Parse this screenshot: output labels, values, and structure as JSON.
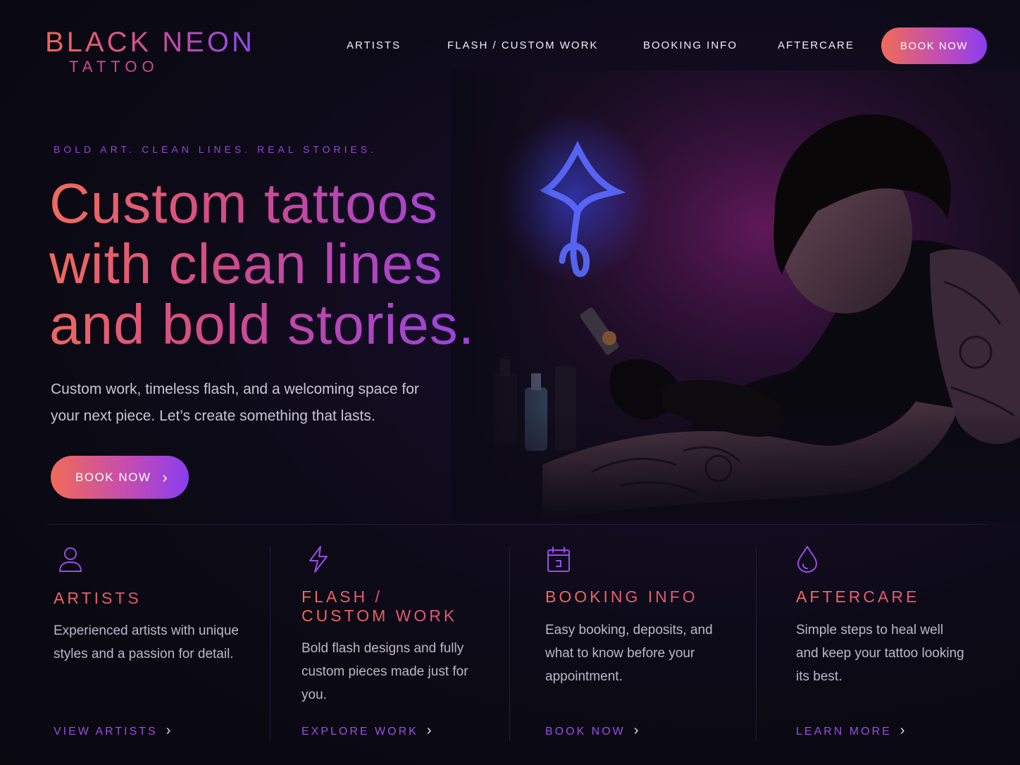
{
  "brand": {
    "name": "BLACK NEON",
    "sub": "TATTOO"
  },
  "nav": {
    "items": [
      "ARTISTS",
      "FLASH / CUSTOM WORK",
      "BOOKING INFO",
      "AFTERCARE"
    ],
    "cta": "BOOK NOW"
  },
  "hero": {
    "eyebrow": "BOLD ART. CLEAN LINES. REAL STORIES.",
    "headline": [
      "Custom tattoos",
      "with clean lines",
      "and bold stories."
    ],
    "description": "Custom work, timeless flash, and a welcoming space for your next piece. Let’s create something that lasts.",
    "cta": "BOOK NOW",
    "cta_icon": "chevron-right-icon"
  },
  "cards": [
    {
      "icon": "user-icon",
      "title": [
        "ARTISTS"
      ],
      "text": "Experienced artists with unique styles and a passion for detail.",
      "link": "VIEW ARTISTS"
    },
    {
      "icon": "lightning-icon",
      "title": [
        "FLASH /",
        "CUSTOM WORK"
      ],
      "text": "Bold flash designs and fully custom pieces made just for you.",
      "link": "EXPLORE WORK"
    },
    {
      "icon": "calendar-icon",
      "title": [
        "BOOKING INFO"
      ],
      "text": "Easy booking, deposits, and what to know before your appointment.",
      "link": "BOOK NOW"
    },
    {
      "icon": "droplet-icon",
      "title": [
        "AFTERCARE"
      ],
      "text": "Simple steps to heal well and keep your tattoo looking its best.",
      "link": "LEARN MORE"
    }
  ],
  "colors": {
    "background": "#0c0a16",
    "accent_coral": "#f06b58",
    "accent_purple": "#8a3ef0",
    "accent_magenta": "#c04ab8",
    "neon_blue": "#4a5cff"
  }
}
